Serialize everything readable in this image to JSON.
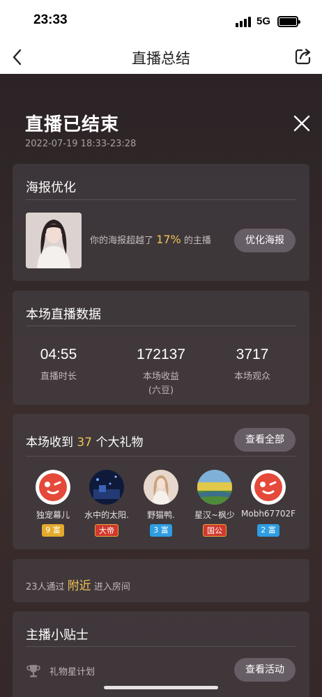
{
  "status_bar": {
    "time": "23:33",
    "network": "5G"
  },
  "nav": {
    "title": "直播总结",
    "back_icon": "chevron-left-icon",
    "share_icon": "share-icon"
  },
  "header": {
    "title": "直播已结束",
    "time_range": "2022-07-19 18:33-23:28",
    "close_icon": "close-icon"
  },
  "poster": {
    "section_title": "海报优化",
    "text_before": "你的海报超越了",
    "percent": "17%",
    "text_after": "的主播",
    "button_label": "优化海报"
  },
  "live_data": {
    "section_title": "本场直播数据",
    "stats": [
      {
        "value": "04:55",
        "label": "直播时长",
        "sublabel": ""
      },
      {
        "value": "172137",
        "label": "本场收益",
        "sublabel": "(六豆)"
      },
      {
        "value": "3717",
        "label": "本场观众",
        "sublabel": ""
      }
    ]
  },
  "gifts": {
    "title_before": "本场收到",
    "count": "37",
    "title_after": "个大礼物",
    "view_all_label": "查看全部",
    "items": [
      {
        "name": "独宠幕儿",
        "badge": "9 富",
        "badge_type": "gold"
      },
      {
        "name": "水中的太阳.",
        "badge": "大帝",
        "badge_type": "red"
      },
      {
        "name": "野猫鸭.",
        "badge": "3 富",
        "badge_type": "blue"
      },
      {
        "name": "星汉~枫少",
        "badge": "国公",
        "badge_type": "red"
      },
      {
        "name": "Mobh67702F",
        "badge": "2 富",
        "badge_type": "blue"
      }
    ]
  },
  "nearby": {
    "text_before": "23人通过",
    "highlight": "附近",
    "text_after": "进入房间"
  },
  "tips": {
    "section_title": "主播小贴士",
    "item_label": "礼物星计划",
    "item_icon": "trophy-icon",
    "button_label": "查看活动"
  },
  "colors": {
    "accent": "#f1c357",
    "background": "#2a2326",
    "card": "#463f46",
    "pill": "#675d65"
  }
}
